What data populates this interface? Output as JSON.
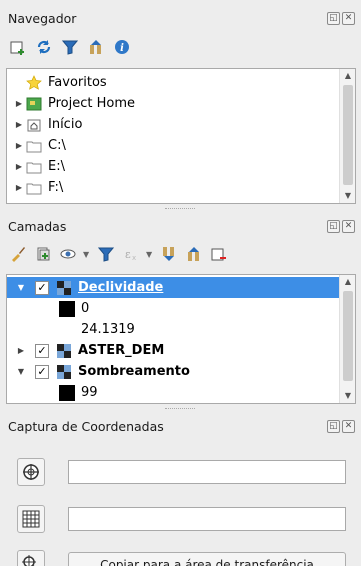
{
  "navigator": {
    "title": "Navegador",
    "items": [
      {
        "label": "Favoritos",
        "icon": "star-icon"
      },
      {
        "label": "Project Home",
        "icon": "project-home-icon"
      },
      {
        "label": "Início",
        "icon": "home-icon"
      },
      {
        "label": "C:\\",
        "icon": "drive-icon"
      },
      {
        "label": "E:\\",
        "icon": "drive-icon"
      },
      {
        "label": "F:\\",
        "icon": "drive-icon"
      }
    ]
  },
  "layers": {
    "title": "Camadas",
    "items": [
      {
        "label": "Declividade",
        "checked": true,
        "selected": true,
        "legend": [
          "0",
          "24.1319"
        ]
      },
      {
        "label": "ASTER_DEM",
        "checked": true,
        "selected": false
      },
      {
        "label": "Sombreamento",
        "checked": true,
        "selected": false,
        "legend": [
          "99"
        ]
      }
    ],
    "check_mark": "✓"
  },
  "coordinate_capture": {
    "title": "Captura de Coordenadas",
    "input1_value": "",
    "input2_value": "",
    "copy_button": "Copiar para a área de transferência"
  },
  "colors": {
    "selection": "#3d8ee6",
    "panel_bg": "#ededed"
  }
}
